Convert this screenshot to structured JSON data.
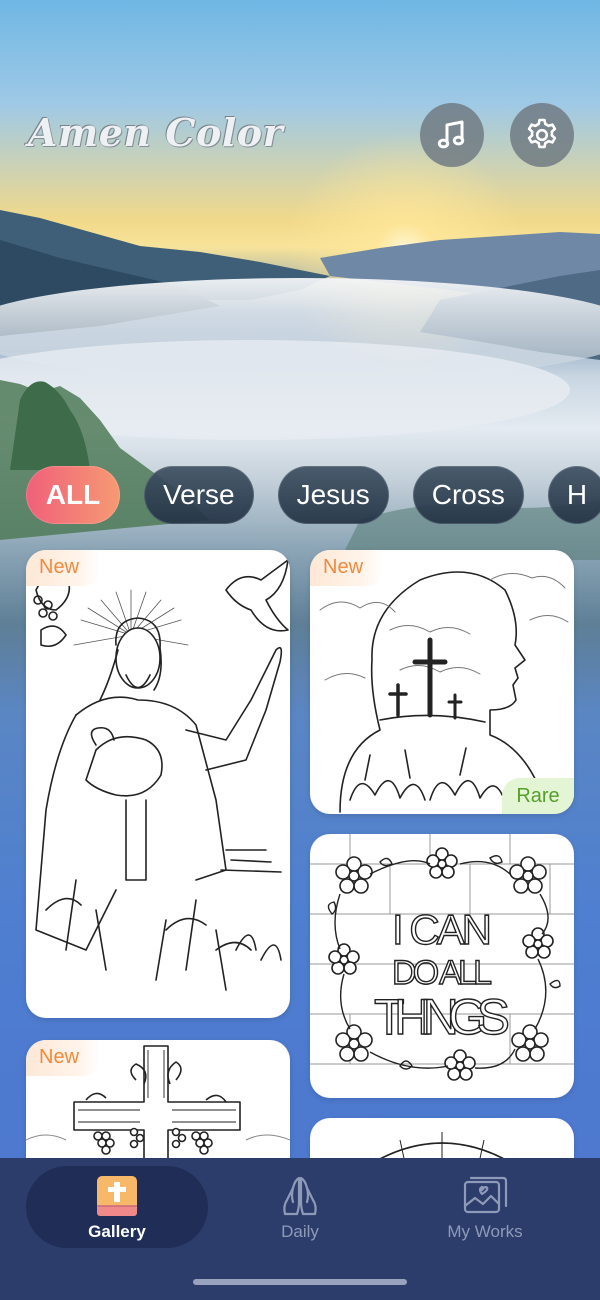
{
  "app": {
    "title": "Amen Color"
  },
  "header": {
    "music_icon": "music-note-icon",
    "settings_icon": "gear-icon"
  },
  "categories": [
    {
      "label": "ALL",
      "active": true
    },
    {
      "label": "Verse",
      "active": false
    },
    {
      "label": "Jesus",
      "active": false
    },
    {
      "label": "Cross",
      "active": false
    },
    {
      "label": "H",
      "active": false
    }
  ],
  "cards": [
    {
      "badge": "New",
      "subject": "jesus-with-lamb-and-dove"
    },
    {
      "badge": "New",
      "rare": "Rare",
      "subject": "silhouette-with-crosses"
    },
    {
      "subject": "floral-verse",
      "art_text": [
        "I CAN",
        "DO ALL",
        "THINGS"
      ]
    },
    {
      "badge": "New",
      "subject": "cross-with-grapes"
    },
    {
      "subject": "arch-partial"
    }
  ],
  "tabbar": {
    "tabs": [
      {
        "label": "Gallery",
        "icon": "bible-cross-icon",
        "active": true
      },
      {
        "label": "Daily",
        "icon": "praying-hands-icon",
        "active": false
      },
      {
        "label": "My Works",
        "icon": "gallery-images-icon",
        "active": false
      }
    ]
  },
  "colors": {
    "accent_start": "#f0607a",
    "accent_end": "#f69a74",
    "tabbar": "#2c3d6c",
    "new_badge": "#f08a3c",
    "rare_badge": "#55a028"
  }
}
